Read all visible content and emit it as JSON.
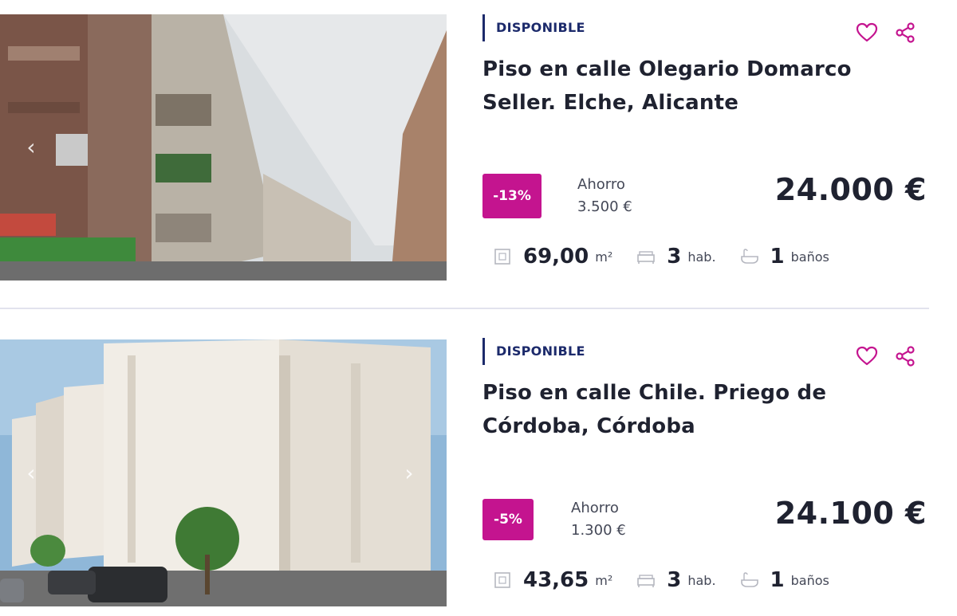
{
  "listings": [
    {
      "status": "DISPONIBLE",
      "title": "Piso en calle Olegario Domarco Seller. Elche, Alicante",
      "discount": "-13%",
      "saving_label": "Ahorro",
      "saving_value": "3.500 €",
      "price": "24.000 €",
      "area_value": "69,00",
      "area_unit": "m²",
      "rooms_value": "3",
      "rooms_unit": "hab.",
      "baths_value": "1",
      "baths_unit": "baños"
    },
    {
      "status": "DISPONIBLE",
      "title": "Piso en calle Chile. Priego de Córdoba, Córdoba",
      "discount": "-5%",
      "saving_label": "Ahorro",
      "saving_value": "1.300 €",
      "price": "24.100 €",
      "area_value": "43,65",
      "area_unit": "m²",
      "rooms_value": "3",
      "rooms_unit": "hab.",
      "baths_value": "1",
      "baths_unit": "baños"
    }
  ],
  "colors": {
    "accent": "#c4148f",
    "status": "#1c2a6b",
    "text": "#1f2230",
    "divider": "#e2e3ee"
  },
  "icons": [
    "chevron-left-icon",
    "chevron-right-icon",
    "heart-icon",
    "share-icon",
    "area-icon",
    "bed-icon",
    "bath-icon"
  ]
}
